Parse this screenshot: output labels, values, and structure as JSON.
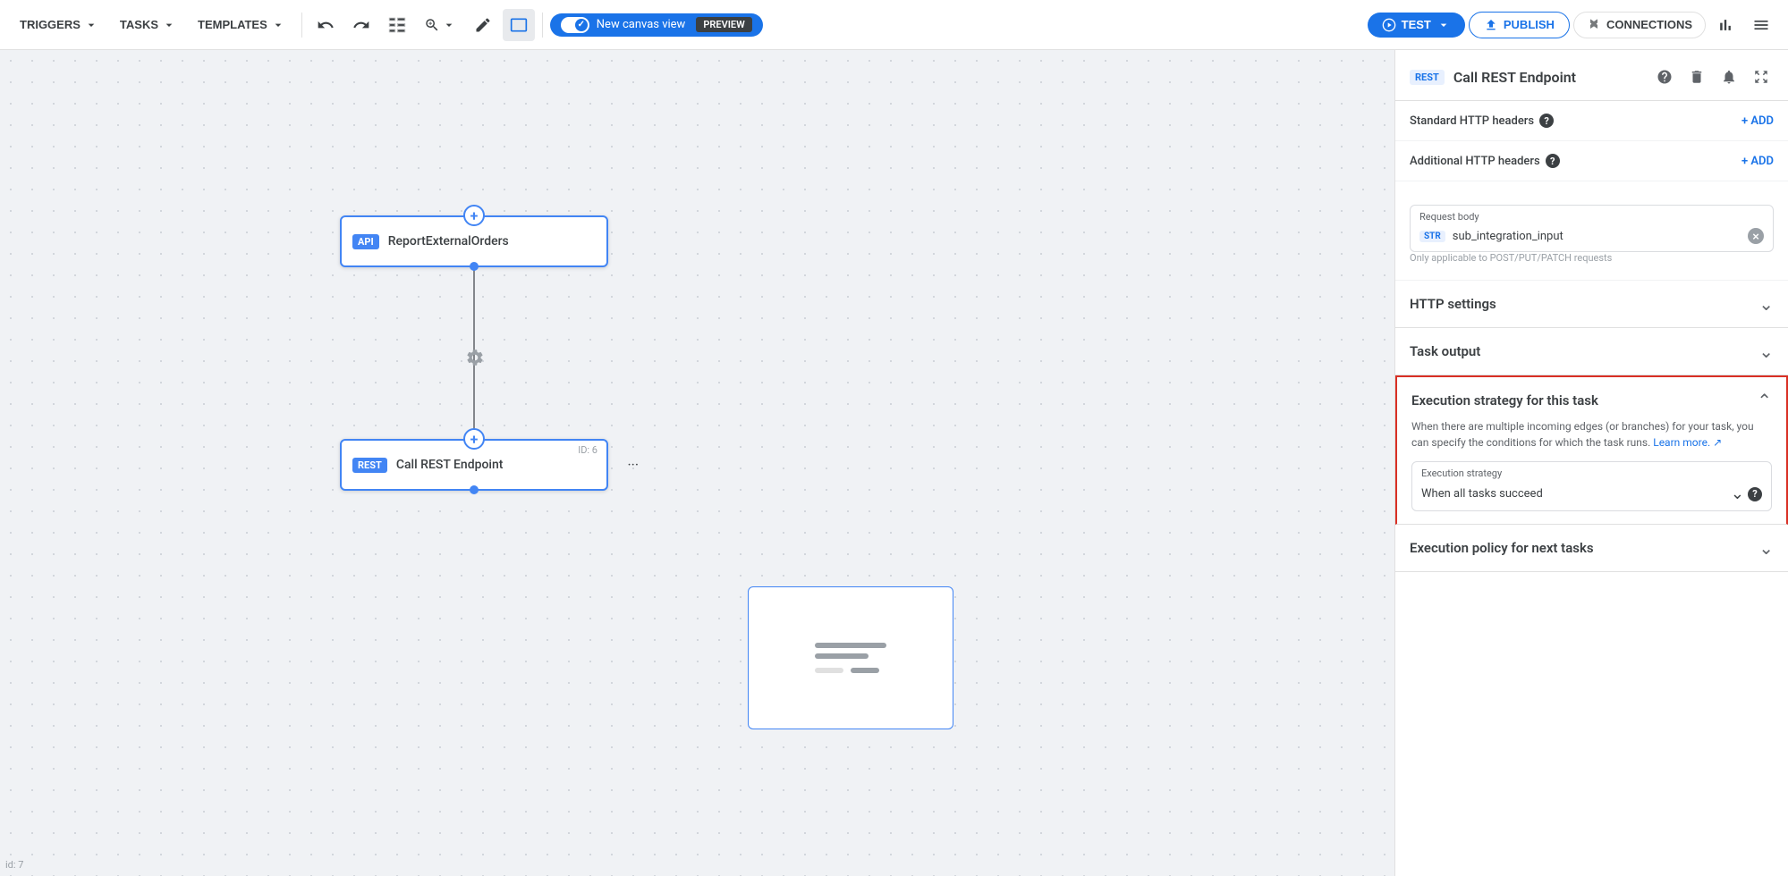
{
  "topnav": {
    "triggers_label": "TRIGGERS",
    "tasks_label": "TASKS",
    "templates_label": "TEMPLATES",
    "canvas_toggle_label": "New canvas view",
    "preview_badge": "PREVIEW",
    "test_label": "TEST",
    "publish_label": "PUBLISH",
    "connections_label": "CONNECTIONS"
  },
  "canvas": {
    "node_api_name": "ReportExternalOrders",
    "node_api_badge": "API",
    "node_rest_name": "Call REST Endpoint",
    "node_rest_badge": "REST",
    "node_rest_id": "ID: 6",
    "id_label": "id: 7"
  },
  "right_panel": {
    "badge": "REST",
    "title": "Call REST Endpoint",
    "std_http_label": "Standard HTTP headers",
    "add_label": "+ ADD",
    "addl_http_label": "Additional HTTP headers",
    "request_body_label": "Request body",
    "str_badge": "STR",
    "request_body_value": "sub_integration_input",
    "request_body_note": "Only applicable to POST/PUT/PATCH requests",
    "http_settings_label": "HTTP settings",
    "task_output_label": "Task output",
    "exec_strategy_section_title": "Execution strategy for this task",
    "exec_strategy_desc_part1": "When there are multiple incoming edges (or branches) for your task, you can specify the conditions for which the task runs.",
    "exec_strategy_link": "Learn more.",
    "exec_strategy_field_label": "Execution strategy",
    "exec_strategy_value": "When all tasks succeed",
    "exec_policy_title": "Execution policy for next tasks"
  }
}
